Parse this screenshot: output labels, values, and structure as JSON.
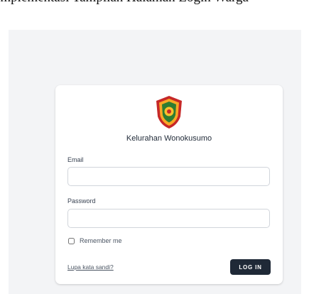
{
  "document": {
    "caption_fragment": "Implementasi Tampilan Halaman Login Warga"
  },
  "login": {
    "org_name": "Kelurahan Wonokusumo",
    "email_label": "Email",
    "email_value": "",
    "password_label": "Password",
    "password_value": "",
    "remember_label": "Remember me",
    "remember_checked": false,
    "forgot_link": "Lupa kata sandi?",
    "login_button": "LOG IN"
  },
  "logo": {
    "icon": "crest-icon",
    "colors": {
      "outer": "#c62828",
      "band": "#f9a825",
      "inner": "#2e7d32",
      "center": "#fbc02d"
    }
  },
  "colors": {
    "page_background": "#f3f4f6",
    "card": "#ffffff",
    "button": "#1f2937",
    "button_text": "#ffffff",
    "input_border": "#d1d5db"
  }
}
